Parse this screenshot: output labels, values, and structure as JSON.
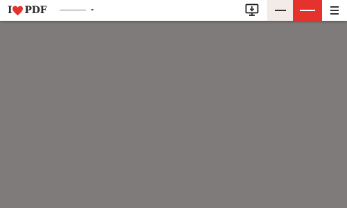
{
  "header": {
    "logo": {
      "prefix": "I",
      "suffix": "PDF",
      "heart_icon": "heart-icon",
      "heart_color": "#e5322d"
    },
    "language_select": {
      "icon": "chevron-down-icon"
    },
    "desktop_button": {
      "icon": "desktop-download-icon"
    },
    "login_button": {
      "background": "#f3ebe8"
    },
    "signup_button": {
      "background": "#e5322d"
    },
    "menu_button": {
      "icon": "hamburger-icon"
    }
  },
  "overlay": {
    "background": "#7f7b7a"
  }
}
